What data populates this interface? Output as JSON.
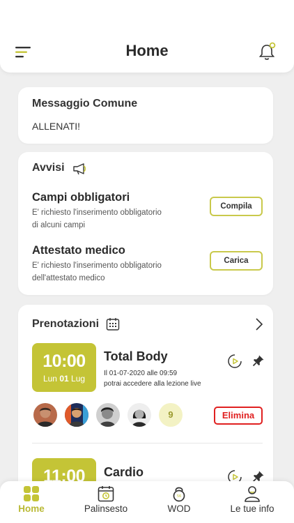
{
  "header": {
    "title": "Home"
  },
  "messaggio": {
    "title": "Messaggio Comune",
    "text": "ALLENATI!"
  },
  "avvisi": {
    "title": "Avvisi",
    "items": [
      {
        "title": "Campi obbligatori",
        "desc_line1": "E' richiesto l'inserimento obbligatorio",
        "desc_line2": "di alcuni campi",
        "button": "Compila"
      },
      {
        "title": "Attestato medico",
        "desc_line1": "E' richiesto l'inserimento obbligatorio",
        "desc_line2": "dell'attestato medico",
        "button": "Carica"
      }
    ]
  },
  "prenotazioni": {
    "title": "Prenotazioni",
    "bookings": [
      {
        "time": "10:00",
        "day": "Lun",
        "daynum": "01",
        "month": "Lug",
        "title": "Total Body",
        "info_line1": "Il 01-07-2020 alle 09:59",
        "info_line2": "potrai accedere alla lezione live",
        "extra_count": "9",
        "delete_label": "Elimina"
      },
      {
        "time": "11:00",
        "title": "Cardio"
      }
    ]
  },
  "nav": {
    "items": [
      {
        "label": "Home",
        "icon": "grid-icon",
        "active": true
      },
      {
        "label": "Palinsesto",
        "icon": "calendar-clock-icon"
      },
      {
        "label": "WOD",
        "icon": "kettlebell-icon"
      },
      {
        "label": "Le tue info",
        "icon": "user-icon"
      }
    ]
  },
  "colors": {
    "accent": "#c4c436",
    "danger": "#e02020",
    "background": "#efefef"
  }
}
